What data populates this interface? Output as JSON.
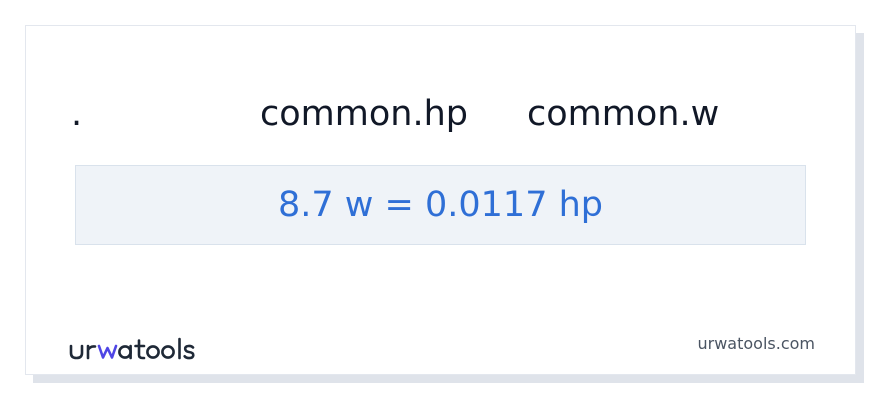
{
  "header": {
    "first_col": ".",
    "from_unit": "common.hp",
    "to_unit": "common.w"
  },
  "result": {
    "text": "8.7 w = 0.0117 hp"
  },
  "footer": {
    "brand": "urwatools",
    "site": "urwatools.com"
  },
  "colors": {
    "text_dark": "#111827",
    "result_blue": "#2f6fd6",
    "logo_accent": "#4f46e5",
    "box_bg": "#eff3f8"
  }
}
